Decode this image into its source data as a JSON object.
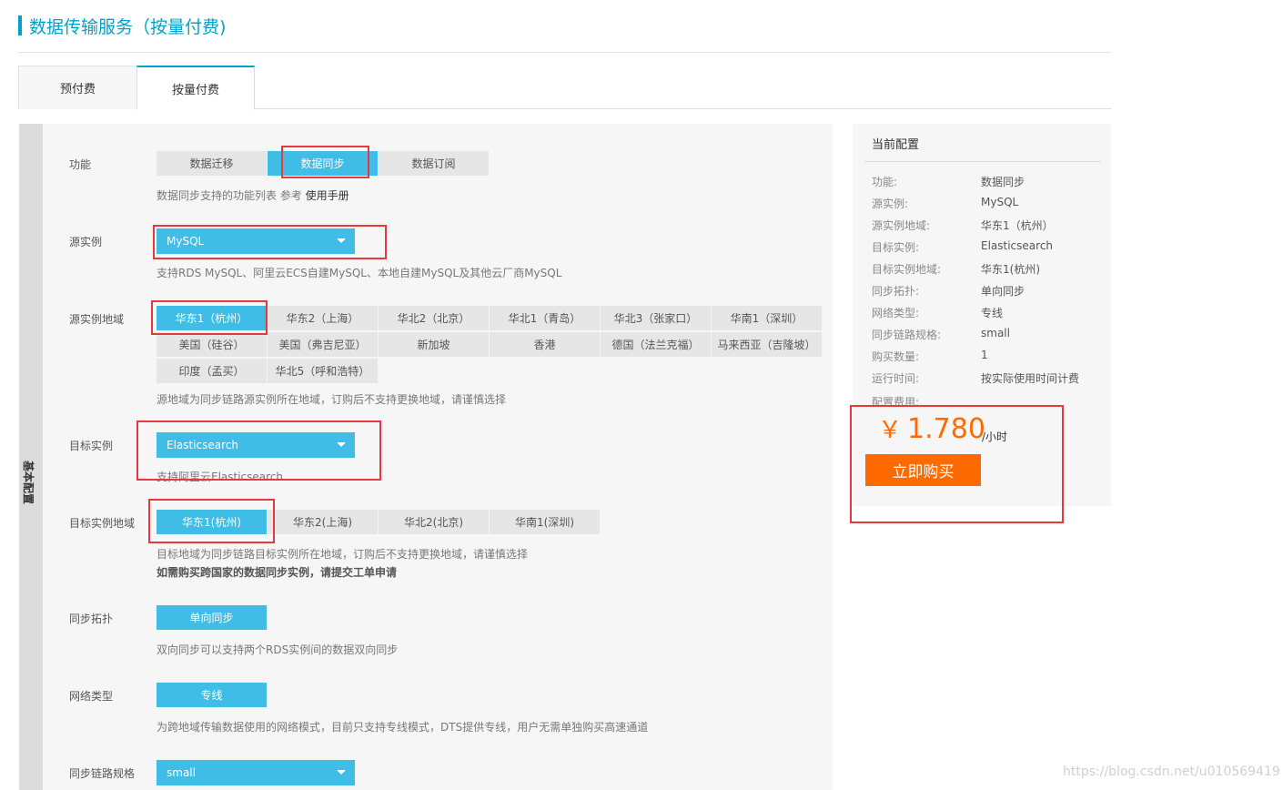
{
  "page": {
    "title": "数据传输服务（按量付费)"
  },
  "tabs": [
    {
      "label": "预付费"
    },
    {
      "label": "按量付费"
    }
  ],
  "side_label": "基本配置",
  "function": {
    "label": "功能",
    "options": [
      "数据迁移",
      "数据同步",
      "数据订阅"
    ],
    "hint": "数据同步支持的功能列表 参考",
    "hint_link": "使用手册"
  },
  "source_instance": {
    "label": "源实例",
    "value": "MySQL",
    "hint": "支持RDS MySQL、阿里云ECS自建MySQL、本地自建MySQL及其他云厂商MySQL"
  },
  "source_region": {
    "label": "源实例地域",
    "options": [
      "华东1（杭州）",
      "华东2（上海）",
      "华北2（北京）",
      "华北1（青岛）",
      "华北3（张家口）",
      "华南1（深圳）",
      "美国（硅谷）",
      "美国（弗吉尼亚）",
      "新加坡",
      "香港",
      "德国（法兰克福）",
      "马来西亚（吉隆坡）",
      "印度（孟买）",
      "华北5（呼和浩特）"
    ],
    "hint": "源地域为同步链路源实例所在地域，订购后不支持更换地域，请谨慎选择"
  },
  "target_instance": {
    "label": "目标实例",
    "value": "Elasticsearch",
    "hint": "支持阿里云Elasticsearch"
  },
  "target_region": {
    "label": "目标实例地域",
    "options": [
      "华东1(杭州)",
      "华东2(上海)",
      "华北2(北京)",
      "华南1(深圳)"
    ],
    "hint": "目标地域为同步链路目标实例所在地域，订购后不支持更换地域，请谨慎选择",
    "hint_bold": "如需购买跨国家的数据同步实例，请提交工单申请"
  },
  "topology": {
    "label": "同步拓扑",
    "value": "单向同步",
    "hint": "双向同步可以支持两个RDS实例间的数据双向同步"
  },
  "network": {
    "label": "网络类型",
    "value": "专线",
    "hint": "为跨地域传输数据使用的网络模式，目前只支持专线模式，DTS提供专线，用户无需单独购买高速通道"
  },
  "spec": {
    "label": "同步链路规格",
    "value": "small"
  },
  "summary": {
    "title": "当前配置",
    "rows": [
      {
        "k": "功能:",
        "v": "数据同步"
      },
      {
        "k": "源实例:",
        "v": "MySQL"
      },
      {
        "k": "源实例地域:",
        "v": "华东1（杭州）"
      },
      {
        "k": "目标实例:",
        "v": "Elasticsearch"
      },
      {
        "k": "目标实例地域:",
        "v": "华东1(杭州)"
      },
      {
        "k": "同步拓扑:",
        "v": "单向同步"
      },
      {
        "k": "网络类型:",
        "v": "专线"
      },
      {
        "k": "同步链路规格:",
        "v": "small"
      },
      {
        "k": "购买数量:",
        "v": "1"
      },
      {
        "k": "运行时间:",
        "v": "按实际使用时间计费"
      }
    ],
    "fee_label": "配置费用:",
    "currency": "￥",
    "price": "1.780",
    "unit": "/小时",
    "buy_label": "立即购买"
  },
  "watermark": "https://blog.csdn.net/u010569419",
  "colors": {
    "accent": "#3fbde6",
    "title": "#00a2ca",
    "buy": "#ff6a00",
    "highlight": "#e8383d"
  }
}
